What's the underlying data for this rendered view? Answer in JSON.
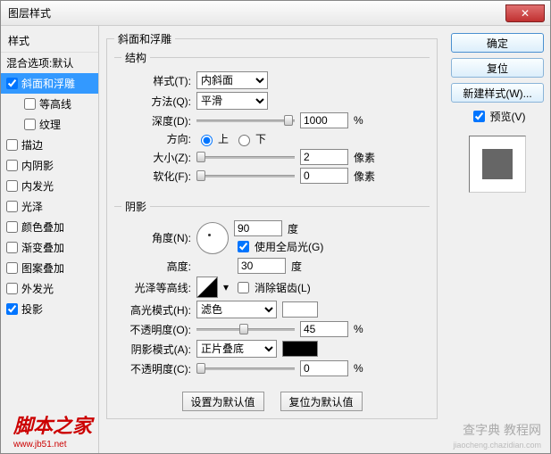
{
  "title": "图层样式",
  "sidebar": {
    "header": "样式",
    "blend": "混合选项:默认",
    "items": [
      {
        "label": "斜面和浮雕",
        "checked": true,
        "selected": true
      },
      {
        "label": "等高线",
        "checked": false,
        "indent": true
      },
      {
        "label": "纹理",
        "checked": false,
        "indent": true
      },
      {
        "label": "描边",
        "checked": false
      },
      {
        "label": "内阴影",
        "checked": false
      },
      {
        "label": "内发光",
        "checked": false
      },
      {
        "label": "光泽",
        "checked": false
      },
      {
        "label": "颜色叠加",
        "checked": false
      },
      {
        "label": "渐变叠加",
        "checked": false
      },
      {
        "label": "图案叠加",
        "checked": false
      },
      {
        "label": "外发光",
        "checked": false
      },
      {
        "label": "投影",
        "checked": true
      }
    ]
  },
  "buttons": {
    "ok": "确定",
    "cancel": "复位",
    "newstyle": "新建样式(W)...",
    "preview": "预览(V)",
    "setdefault": "设置为默认值",
    "resetdefault": "复位为默认值"
  },
  "main": {
    "group_title": "斜面和浮雕",
    "struct_title": "结构",
    "style_label": "样式(T):",
    "style_value": "内斜面",
    "method_label": "方法(Q):",
    "method_value": "平滑",
    "depth_label": "深度(D):",
    "depth_value": "1000",
    "depth_unit": "%",
    "direction_label": "方向:",
    "up": "上",
    "down": "下",
    "size_label": "大小(Z):",
    "size_value": "2",
    "size_unit": "像素",
    "soften_label": "软化(F):",
    "soften_value": "0",
    "soften_unit": "像素",
    "shadow_title": "阴影",
    "angle_label": "角度(N):",
    "angle_value": "90",
    "angle_unit": "度",
    "global_label": "使用全局光(G)",
    "altitude_label": "高度:",
    "altitude_value": "30",
    "altitude_unit": "度",
    "gloss_label": "光泽等高线:",
    "antialias_label": "消除锯齿(L)",
    "highlight_mode_label": "高光模式(H):",
    "highlight_mode_value": "滤色",
    "highlight_opacity_label": "不透明度(O):",
    "highlight_opacity_value": "45",
    "opacity_unit": "%",
    "shadow_mode_label": "阴影模式(A):",
    "shadow_mode_value": "正片叠底",
    "shadow_opacity_label": "不透明度(C):",
    "shadow_opacity_value": "0"
  },
  "watermark": {
    "l1": "脚本之家",
    "l2": "www.jb51.net",
    "r1": "查字典 教程网",
    "r2": "jiaocheng.chazidian.com"
  }
}
